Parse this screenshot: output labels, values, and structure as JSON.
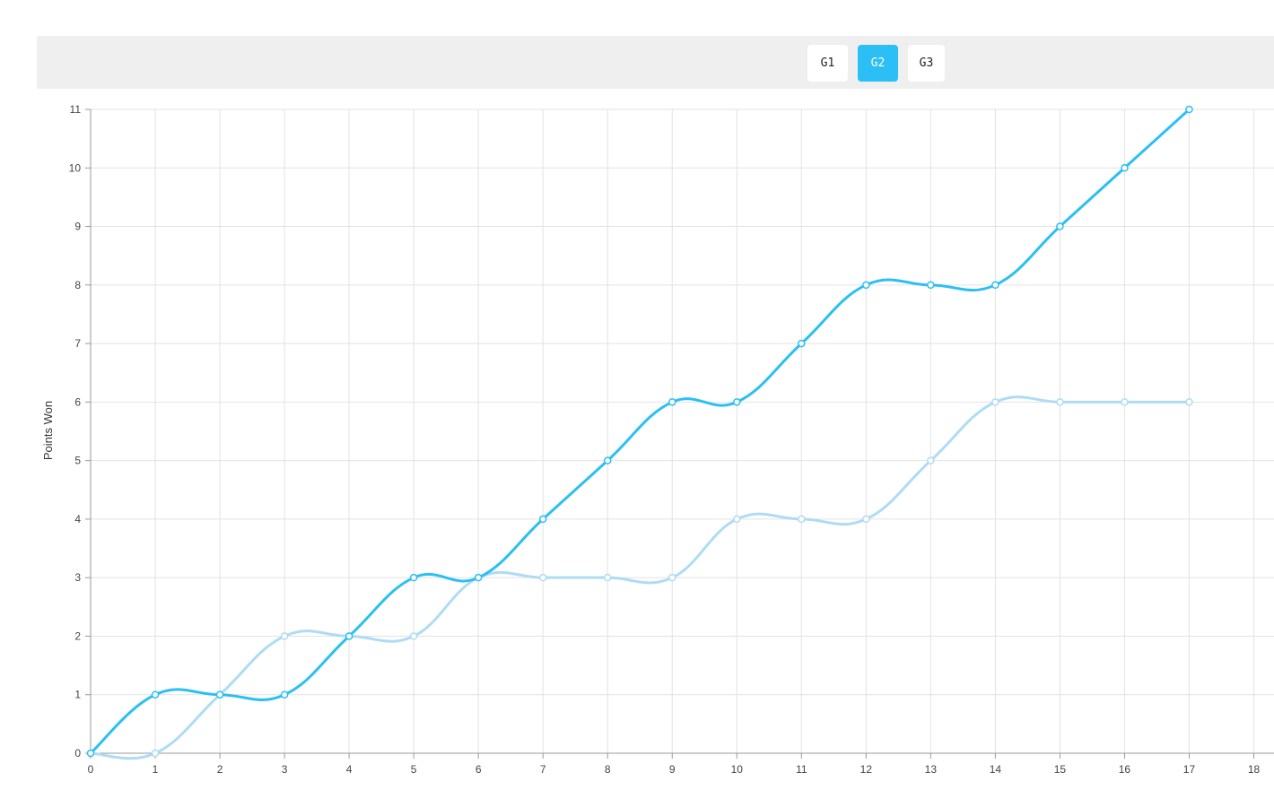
{
  "toolbar": {
    "tabs": [
      {
        "label": "G1",
        "active": false
      },
      {
        "label": "G2",
        "active": true
      },
      {
        "label": "G3",
        "active": false
      }
    ]
  },
  "colors": {
    "accent": "#2bbff5",
    "series_primary": "#2bbff5",
    "series_secondary": "#aedcf4",
    "grid": "#e2e2e2",
    "axis": "#999999"
  },
  "chart_data": {
    "type": "line",
    "title": "",
    "xlabel": "",
    "ylabel": "Points Won",
    "xlim": [
      0,
      18
    ],
    "ylim": [
      0,
      11
    ],
    "x_ticks": [
      0,
      1,
      2,
      3,
      4,
      5,
      6,
      7,
      8,
      9,
      10,
      11,
      12,
      13,
      14,
      15,
      16,
      17,
      18
    ],
    "y_ticks": [
      0,
      1,
      2,
      3,
      4,
      5,
      6,
      7,
      8,
      9,
      10,
      11
    ],
    "grid": true,
    "x": [
      0,
      1,
      2,
      3,
      4,
      5,
      6,
      7,
      8,
      9,
      10,
      11,
      12,
      13,
      14,
      15,
      16,
      17
    ],
    "series": [
      {
        "color": "#2bbff5",
        "values": [
          0,
          1,
          1,
          1,
          2,
          3,
          3,
          4,
          5,
          6,
          6,
          7,
          8,
          8,
          8,
          9,
          10,
          11
        ]
      },
      {
        "color": "#aedcf4",
        "values": [
          0,
          0,
          1,
          2,
          2,
          2,
          3,
          3,
          3,
          3,
          4,
          4,
          4,
          5,
          6,
          6,
          6,
          6
        ]
      }
    ]
  }
}
